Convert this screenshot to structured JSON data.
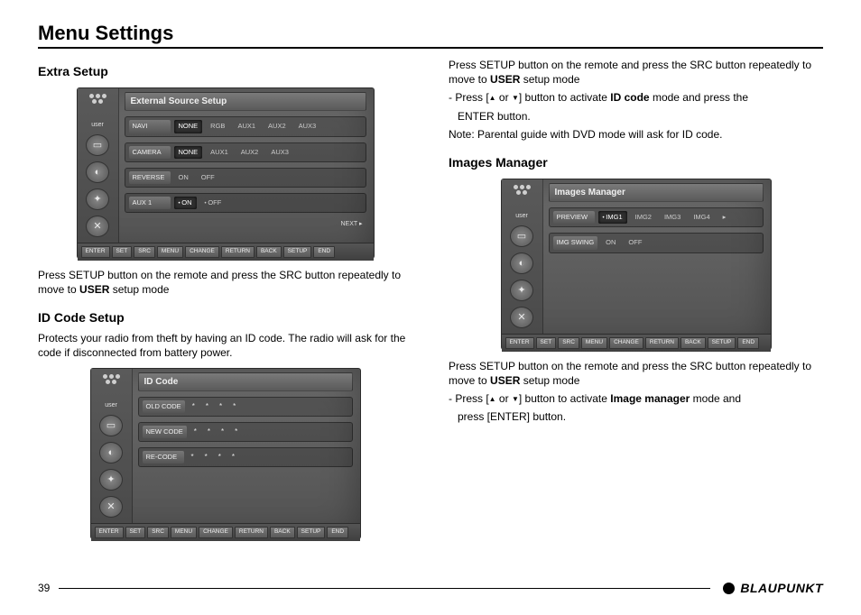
{
  "page_title": "Menu Settings",
  "page_number": "39",
  "brand": "BLAUPUNKT",
  "left": {
    "section1_title": "Extra Setup",
    "section1_text_a": "Press SETUP button on the remote and press the SRC button repeatedly to move to ",
    "section1_text_b": " setup mode",
    "user_word": "USER",
    "section2_title": "ID Code Setup",
    "section2_text": "Protects your radio from theft by having an ID code.  The radio will ask for the code if disconnected from battery power."
  },
  "right": {
    "intro_a": "Press SETUP button on the remote and press the SRC button repeatedly to move to ",
    "intro_b": " setup mode",
    "user_word": "USER",
    "line2_a": "- Press [",
    "line2_b": " or ",
    "line2_c": "] button to activate ",
    "idcode_word": "ID code",
    "line2_d": " mode and press the",
    "line2_e": "ENTER button.",
    "note": "Note: Parental guide with DVD mode will ask for ID code.",
    "section_title": "Images Manager",
    "img_intro_a": "Press SETUP button on the remote and press the SRC button repeatedly to move to ",
    "img_intro_b": " setup mode",
    "img_line2_a": "- Press [",
    "img_line2_b": " or ",
    "img_line2_c": "] button to activate ",
    "imgmgr_word": "Image manager",
    "img_line2_d": " mode and",
    "img_line2_e": "press [ENTER] button."
  },
  "osd": {
    "side_label": "user",
    "bottom": [
      "ENTER",
      "SET",
      "SRC",
      "MENU",
      "CHANGE",
      "RETURN",
      "BACK",
      "SETUP",
      "END"
    ],
    "ext": {
      "title": "External Source Setup",
      "rows": [
        {
          "label": "NAVI",
          "opts": [
            "NONE",
            "RGB",
            "AUX1",
            "AUX2",
            "AUX3"
          ],
          "sel": 0
        },
        {
          "label": "CAMERA",
          "opts": [
            "NONE",
            "AUX1",
            "AUX2",
            "AUX3"
          ],
          "sel": 0
        },
        {
          "label": "REVERSE",
          "opts": [
            "ON",
            "OFF"
          ],
          "sel": -1
        },
        {
          "label": "AUX 1",
          "opts": [
            "ON",
            "OFF"
          ],
          "sel": 0,
          "dot": true
        }
      ],
      "next": "NEXT ▸"
    },
    "idcode": {
      "title": "ID Code",
      "rows": [
        {
          "label": "OLD CODE"
        },
        {
          "label": "NEW CODE"
        },
        {
          "label": "RE-CODE"
        }
      ]
    },
    "img": {
      "title": "Images Manager",
      "rows": [
        {
          "label": "PREVIEW",
          "opts": [
            "IMG1",
            "IMG2",
            "IMG3",
            "IMG4"
          ],
          "sel": 0,
          "dot": true,
          "arrow": true
        },
        {
          "label": "IMG SWING",
          "opts": [
            "ON",
            "OFF"
          ],
          "sel": -1
        }
      ]
    }
  }
}
